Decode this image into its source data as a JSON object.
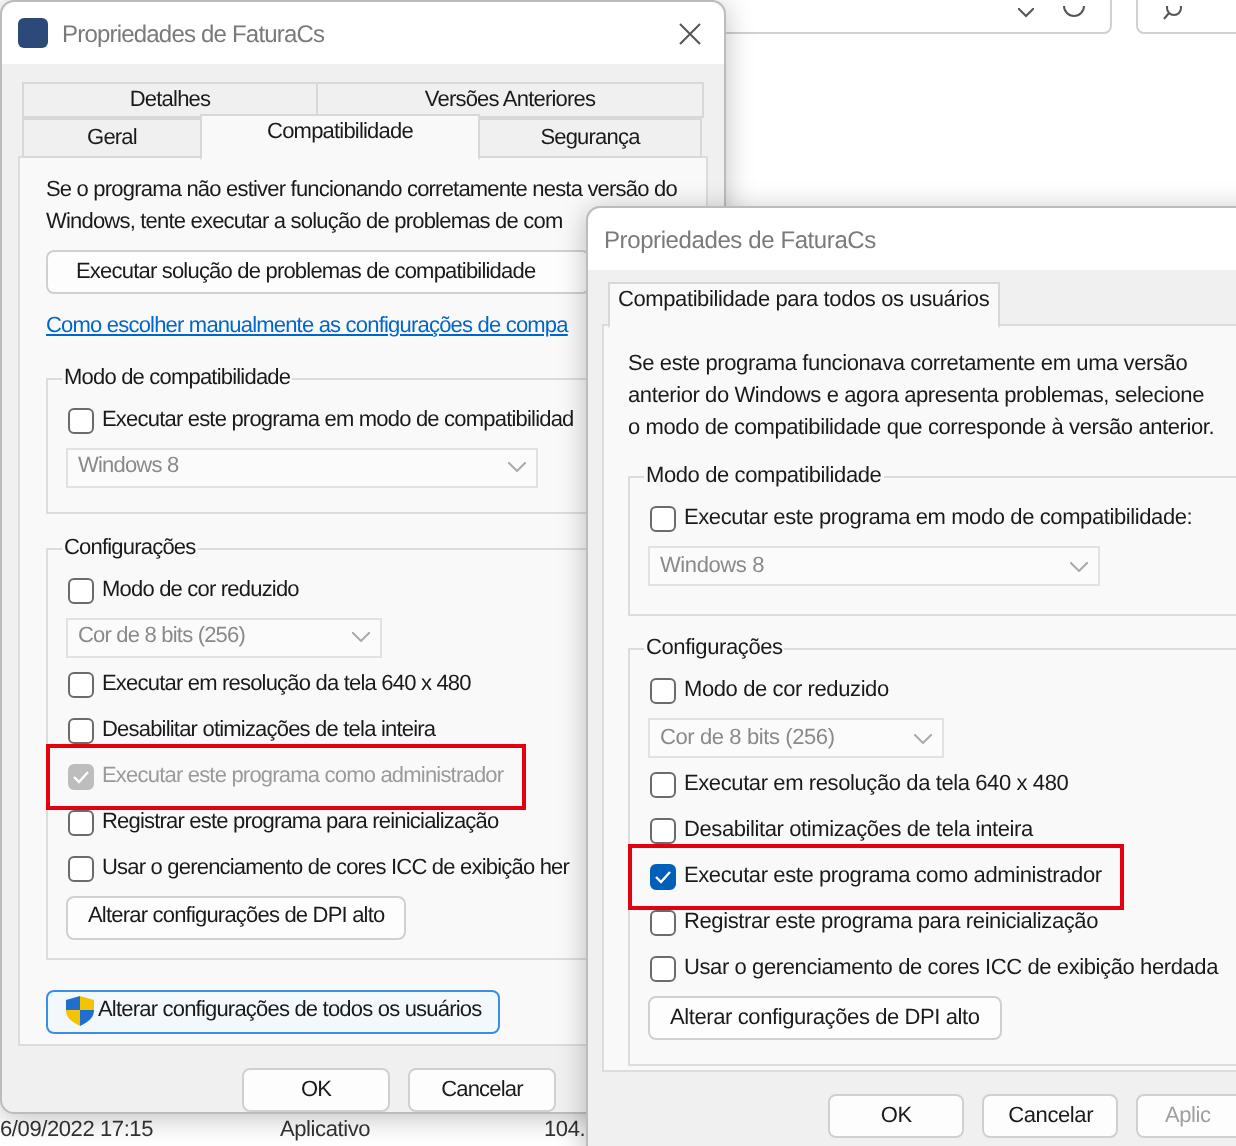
{
  "file_row": [
    "6/09/2022 17:15",
    "Aplicativo",
    "104."
  ],
  "dialogs": [
    {
      "title": "Propriedades de FaturaCs",
      "tab_rows": [
        [
          {
            "label": "Detalhes",
            "selected": false
          },
          {
            "label": "Versões Anteriores",
            "selected": false
          }
        ],
        [
          {
            "label": "Geral",
            "selected": false
          },
          {
            "label": "Compatibilidade",
            "selected": true
          },
          {
            "label": "Segurança",
            "selected": false
          }
        ]
      ],
      "intro_lines": [
        "Se o programa não estiver funcionando corretamente nesta versão do",
        "Windows, tente executar a solução de problemas de com"
      ],
      "troubleshoot_button": "Executar solução de problemas de compatibilidade",
      "link": "Como escolher manualmente as configurações de compa",
      "groups": [
        {
          "legend": "Modo de compatibilidade",
          "items": [
            {
              "kind": "checkbox",
              "label": "Executar este programa em modo de compatibilidad",
              "checked": false,
              "disabled": false,
              "highlighted": false
            },
            {
              "kind": "select",
              "value": "Windows 8",
              "disabled": true
            }
          ]
        },
        {
          "legend": "Configurações",
          "items": [
            {
              "kind": "checkbox",
              "label": "Modo de cor reduzido",
              "checked": false,
              "disabled": false,
              "highlighted": false
            },
            {
              "kind": "select",
              "value": "Cor de 8 bits (256)",
              "disabled": true
            },
            {
              "kind": "checkbox",
              "label": "Executar em resolução da tela 640 x 480",
              "checked": false,
              "disabled": false,
              "highlighted": false
            },
            {
              "kind": "checkbox",
              "label": "Desabilitar otimizações de tela inteira",
              "checked": false,
              "disabled": false,
              "highlighted": false
            },
            {
              "kind": "checkbox",
              "label": "Executar este programa como administrador",
              "checked": true,
              "disabled": true,
              "highlighted": true
            },
            {
              "kind": "checkbox",
              "label": "Registrar este programa para reinicialização",
              "checked": false,
              "disabled": false,
              "highlighted": false
            },
            {
              "kind": "checkbox",
              "label": "Usar o gerenciamento de cores ICC de exibição her",
              "checked": false,
              "disabled": false,
              "highlighted": false
            },
            {
              "kind": "button",
              "label": "Alterar configurações de DPI alto"
            }
          ]
        }
      ],
      "all_users_button": "Alterar configurações de todos os usuários",
      "buttons": [
        {
          "label": "OK",
          "disabled": false
        },
        {
          "label": "Cancelar",
          "disabled": false
        }
      ]
    },
    {
      "title": "Propriedades de FaturaCs",
      "tab_rows": [
        [
          {
            "label": "Compatibilidade para todos os usuários",
            "selected": true
          }
        ]
      ],
      "intro": "Se este programa funcionava corretamente em uma versão anterior do Windows e agora apresenta problemas, selecione o modo de compatibilidade que corresponde à versão anterior.",
      "groups": [
        {
          "legend": "Modo de compatibilidade",
          "items": [
            {
              "kind": "checkbox",
              "label": "Executar este programa em modo de compatibilidade:",
              "checked": false,
              "disabled": false,
              "highlighted": false
            },
            {
              "kind": "select",
              "value": "Windows 8",
              "disabled": true
            }
          ]
        },
        {
          "legend": "Configurações",
          "items": [
            {
              "kind": "checkbox",
              "label": "Modo de cor reduzido",
              "checked": false,
              "disabled": false,
              "highlighted": false
            },
            {
              "kind": "select",
              "value": "Cor de 8 bits (256)",
              "disabled": true
            },
            {
              "kind": "checkbox",
              "label": "Executar em resolução da tela 640 x 480",
              "checked": false,
              "disabled": false,
              "highlighted": false
            },
            {
              "kind": "checkbox",
              "label": "Desabilitar otimizações de tela inteira",
              "checked": false,
              "disabled": false,
              "highlighted": false
            },
            {
              "kind": "checkbox",
              "label": "Executar este programa como administrador",
              "checked": true,
              "disabled": false,
              "highlighted": true
            },
            {
              "kind": "checkbox",
              "label": "Registrar este programa para reinicialização",
              "checked": false,
              "disabled": false,
              "highlighted": false
            },
            {
              "kind": "checkbox",
              "label": "Usar o gerenciamento de cores ICC de exibição herdada",
              "checked": false,
              "disabled": false,
              "highlighted": false
            },
            {
              "kind": "button",
              "label": "Alterar configurações de DPI alto"
            }
          ]
        }
      ],
      "buttons": [
        {
          "label": "OK",
          "disabled": false
        },
        {
          "label": "Cancelar",
          "disabled": false
        },
        {
          "label": "Aplic",
          "disabled": true
        }
      ]
    }
  ]
}
